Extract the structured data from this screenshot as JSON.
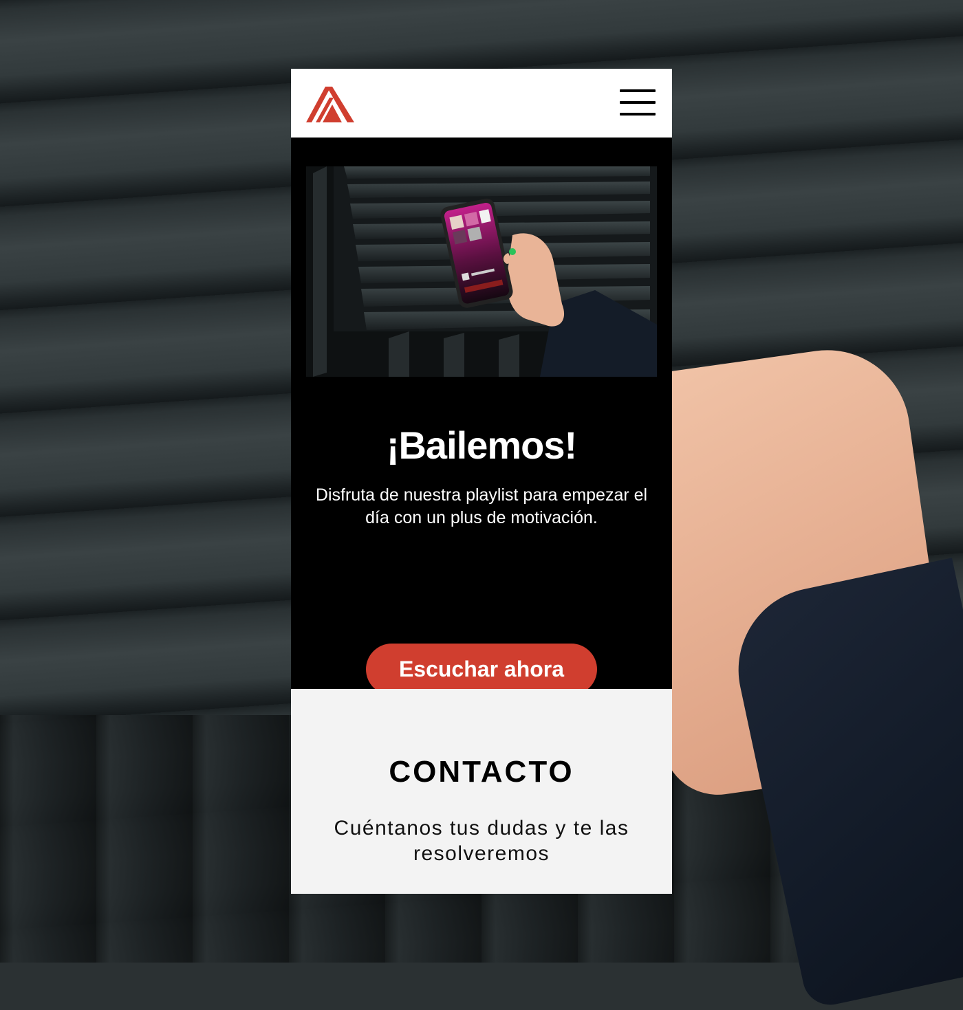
{
  "nav": {
    "logo_icon": "brand-logo-icon",
    "menu_icon": "hamburger-menu-icon",
    "brand_color": "#d03e2f"
  },
  "hero": {
    "image": "phone-music-app-photo",
    "title": "¡Bailemos!",
    "description": "Disfruta de nuestra playlist para empezar el día con un plus de motivación.",
    "cta_label": "Escuchar ahora"
  },
  "contact": {
    "title": "CONTACTO",
    "description": "Cuéntanos tus dudas y te las resolveremos"
  }
}
